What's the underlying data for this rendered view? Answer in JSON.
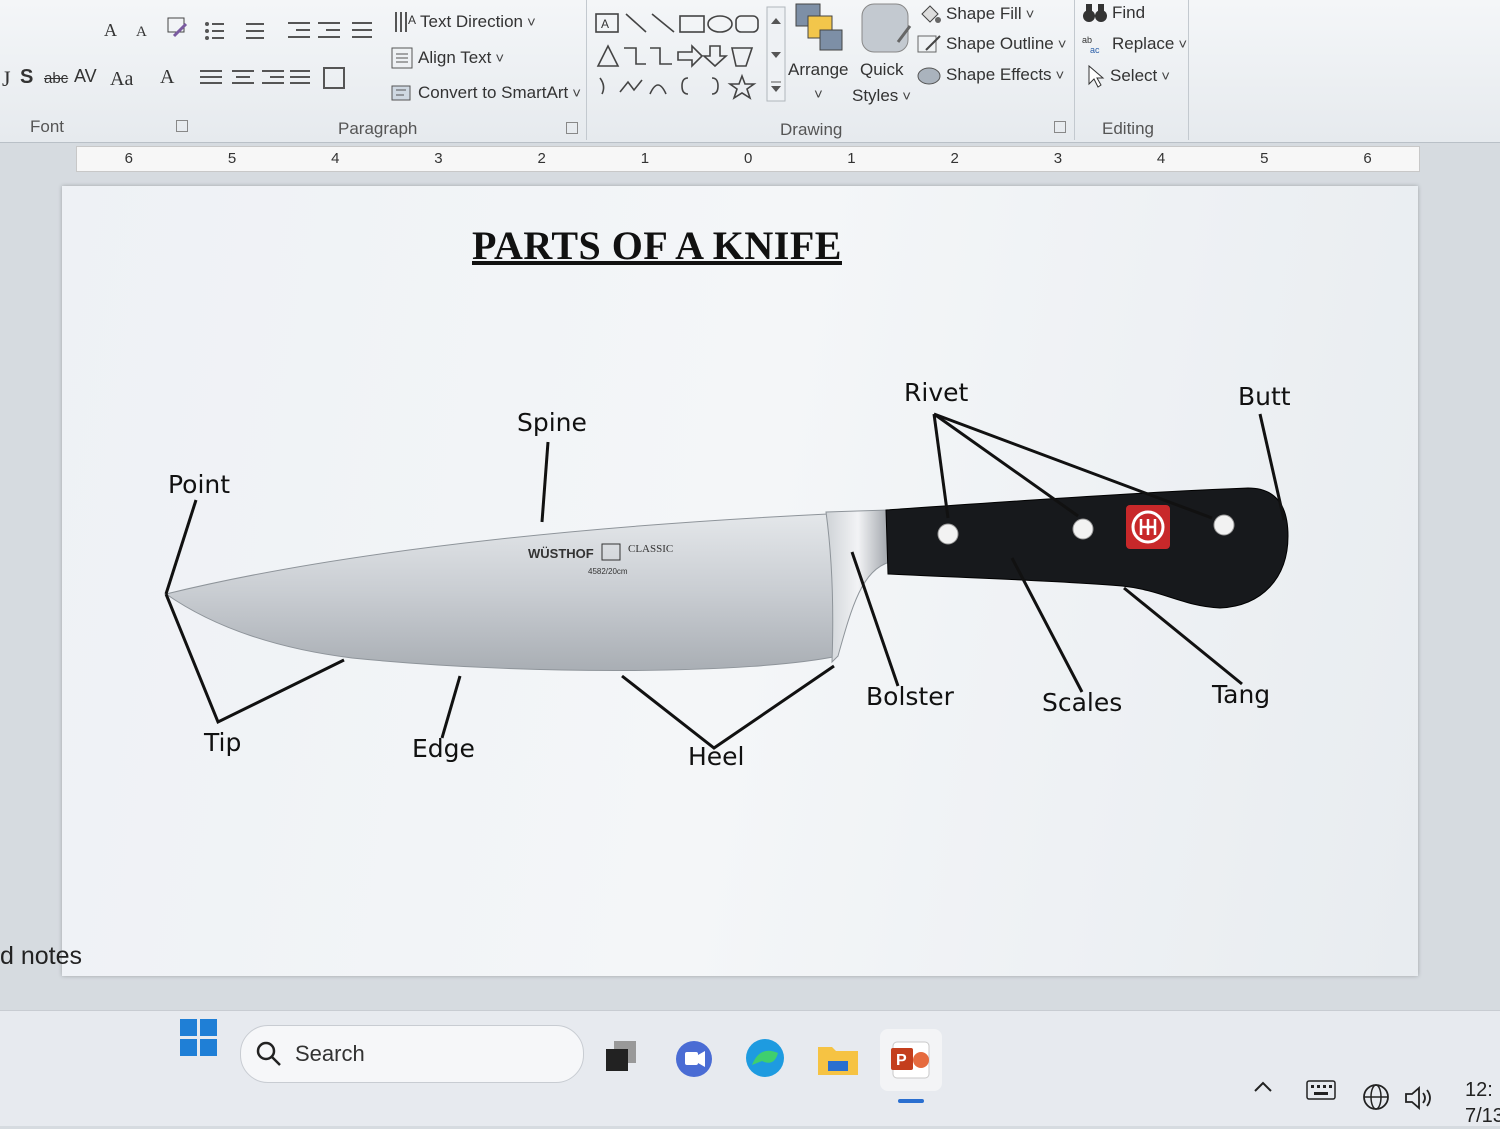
{
  "ribbon": {
    "groups": {
      "font": "Font",
      "paragraph": "Paragraph",
      "drawing": "Drawing",
      "editing": "Editing"
    },
    "paragraph": {
      "text_direction": "Text Direction",
      "align_text": "Align Text",
      "convert_smartart": "Convert to SmartArt"
    },
    "drawing": {
      "arrange": "Arrange",
      "quick": "Quick",
      "styles": "Styles",
      "shape_fill": "Shape Fill",
      "shape_outline": "Shape Outline",
      "shape_effects": "Shape Effects"
    },
    "editing": {
      "find": "Find",
      "replace": "Replace",
      "select": "Select"
    },
    "font": {
      "grow": "A",
      "shrink": "A",
      "strike": "abc",
      "spacing": "AV",
      "case": "Aa",
      "shadow": "S",
      "color": "A"
    }
  },
  "ruler": {
    "ticks": [
      "6",
      "5",
      "4",
      "3",
      "2",
      "1",
      "0",
      "1",
      "2",
      "3",
      "4",
      "5",
      "6"
    ]
  },
  "slide": {
    "title": "PARTS OF A KNIFE",
    "brand_text": "WÜSTHOF",
    "brand_sub": "CLASSIC",
    "brand_size": "4582/20cm",
    "labels": {
      "point": "Point",
      "spine": "Spine",
      "rivet": "Rivet",
      "butt": "Butt",
      "tip": "Tip",
      "edge": "Edge",
      "heel": "Heel",
      "bolster": "Bolster",
      "scales": "Scales",
      "tang": "Tang"
    },
    "colors": {
      "handle": "#17191c",
      "blade": "#c9cdd2",
      "logo": "#c8282a"
    }
  },
  "notes_label": "d notes",
  "taskbar": {
    "search_placeholder": "Search",
    "clock_time": "12:",
    "clock_date": "7/13"
  }
}
